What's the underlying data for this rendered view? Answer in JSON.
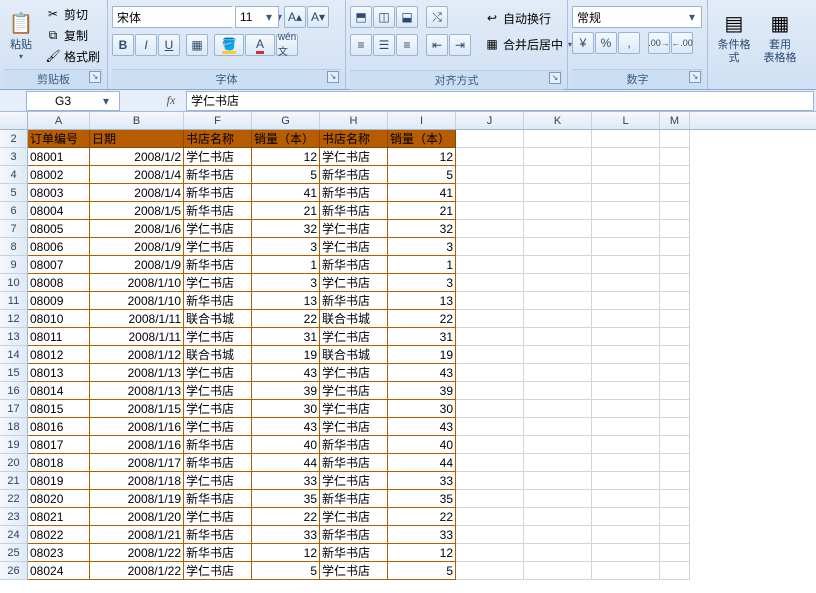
{
  "ribbon": {
    "clipboard": {
      "paste": "粘贴",
      "cut": "剪切",
      "copy": "复制",
      "format_painter": "格式刷",
      "label": "剪贴板"
    },
    "font": {
      "family": "宋体",
      "size": "11",
      "bold": "B",
      "italic": "I",
      "underline": "U",
      "label": "字体"
    },
    "align": {
      "wrap": "自动换行",
      "merge": "合并后居中",
      "label": "对齐方式"
    },
    "number": {
      "format": "常规",
      "label": "数字"
    },
    "styles": {
      "cond": "条件格式",
      "table": "套用\n表格格"
    }
  },
  "namebox": "G3",
  "formula": "学仁书店",
  "cols": {
    "A": 62,
    "B": 94,
    "C": 0,
    "D": 0,
    "E": 0,
    "F": 68,
    "G": 68,
    "H": 68,
    "I": 68,
    "J": 68,
    "K": 68,
    "L": 68,
    "M": 30
  },
  "headers": [
    "订单编号",
    "日期",
    "书店名称",
    "销量（本）",
    "书店名称",
    "销量（本）"
  ],
  "rows": [
    [
      "08001",
      "2008/1/2",
      "学仁书店",
      "12",
      "学仁书店",
      "12"
    ],
    [
      "08002",
      "2008/1/4",
      "新华书店",
      "5",
      "新华书店",
      "5"
    ],
    [
      "08003",
      "2008/1/4",
      "新华书店",
      "41",
      "新华书店",
      "41"
    ],
    [
      "08004",
      "2008/1/5",
      "新华书店",
      "21",
      "新华书店",
      "21"
    ],
    [
      "08005",
      "2008/1/6",
      "学仁书店",
      "32",
      "学仁书店",
      "32"
    ],
    [
      "08006",
      "2008/1/9",
      "学仁书店",
      "3",
      "学仁书店",
      "3"
    ],
    [
      "08007",
      "2008/1/9",
      "新华书店",
      "1",
      "新华书店",
      "1"
    ],
    [
      "08008",
      "2008/1/10",
      "学仁书店",
      "3",
      "学仁书店",
      "3"
    ],
    [
      "08009",
      "2008/1/10",
      "新华书店",
      "13",
      "新华书店",
      "13"
    ],
    [
      "08010",
      "2008/1/11",
      "联合书城",
      "22",
      "联合书城",
      "22"
    ],
    [
      "08011",
      "2008/1/11",
      "学仁书店",
      "31",
      "学仁书店",
      "31"
    ],
    [
      "08012",
      "2008/1/12",
      "联合书城",
      "19",
      "联合书城",
      "19"
    ],
    [
      "08013",
      "2008/1/13",
      "学仁书店",
      "43",
      "学仁书店",
      "43"
    ],
    [
      "08014",
      "2008/1/13",
      "学仁书店",
      "39",
      "学仁书店",
      "39"
    ],
    [
      "08015",
      "2008/1/15",
      "学仁书店",
      "30",
      "学仁书店",
      "30"
    ],
    [
      "08016",
      "2008/1/16",
      "学仁书店",
      "43",
      "学仁书店",
      "43"
    ],
    [
      "08017",
      "2008/1/16",
      "新华书店",
      "40",
      "新华书店",
      "40"
    ],
    [
      "08018",
      "2008/1/17",
      "新华书店",
      "44",
      "新华书店",
      "44"
    ],
    [
      "08019",
      "2008/1/18",
      "学仁书店",
      "33",
      "学仁书店",
      "33"
    ],
    [
      "08020",
      "2008/1/19",
      "新华书店",
      "35",
      "新华书店",
      "35"
    ],
    [
      "08021",
      "2008/1/20",
      "学仁书店",
      "22",
      "学仁书店",
      "22"
    ],
    [
      "08022",
      "2008/1/21",
      "新华书店",
      "33",
      "新华书店",
      "33"
    ],
    [
      "08023",
      "2008/1/22",
      "新华书店",
      "12",
      "新华书店",
      "12"
    ],
    [
      "08024",
      "2008/1/22",
      "学仁书店",
      "5",
      "学仁书店",
      "5"
    ]
  ]
}
